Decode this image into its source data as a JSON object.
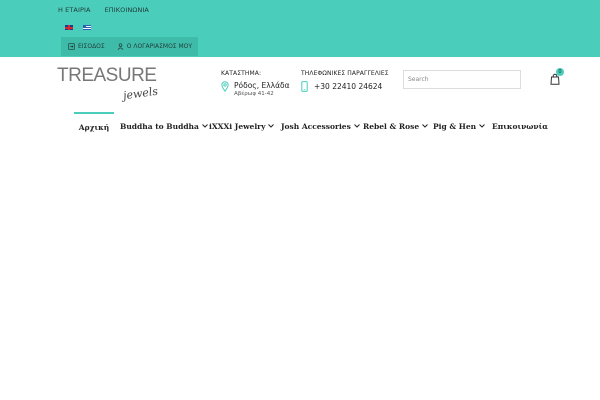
{
  "topbar": {
    "links": [
      "Η ΕΤΑΙΡΙΑ",
      "ΕΠΙΚΟΙΝΩΝΙΑ"
    ],
    "languages": [
      {
        "code": "en",
        "icon": "uk-flag-icon"
      },
      {
        "code": "el",
        "icon": "greek-flag-icon"
      }
    ],
    "account": {
      "login_label": "ΕΙΣΟΔΟΣ",
      "my_account_label": "Ο ΛΟΓΑΡΙΑΣΜΟΣ ΜΟΥ"
    }
  },
  "logo": {
    "word": "TREASURE",
    "script": "jewels"
  },
  "store": {
    "label": "ΚΑΤΑΣΤΗΜΑ:",
    "line1": "Ρόδος, Ελλάδα",
    "line2": "Αβέρωφ 41-42"
  },
  "phone": {
    "label": "ΤΗΛΕΦΩΝΙΚΕΣ ΠΑΡΑΓΓΕΛΙΕΣ",
    "number": "+30 22410 24624"
  },
  "search": {
    "placeholder": "Search",
    "value": ""
  },
  "cart": {
    "count": "0"
  },
  "nav": {
    "items": [
      {
        "label": "Αρχική",
        "has_dropdown": false,
        "active": true
      },
      {
        "label": "Buddha to Buddha",
        "has_dropdown": true,
        "active": false
      },
      {
        "label": "iXXXi Jewelry",
        "has_dropdown": true,
        "active": false
      },
      {
        "label": "Josh Accessories",
        "has_dropdown": true,
        "active": false
      },
      {
        "label": "Rebel & Rose",
        "has_dropdown": true,
        "active": false
      },
      {
        "label": "Pig & Hen",
        "has_dropdown": true,
        "active": false
      },
      {
        "label": "Επικοινωνία",
        "has_dropdown": false,
        "active": false
      }
    ]
  },
  "colors": {
    "accent": "#4bcdbc",
    "accent_dark": "#3fbba9",
    "text": "#222222"
  }
}
